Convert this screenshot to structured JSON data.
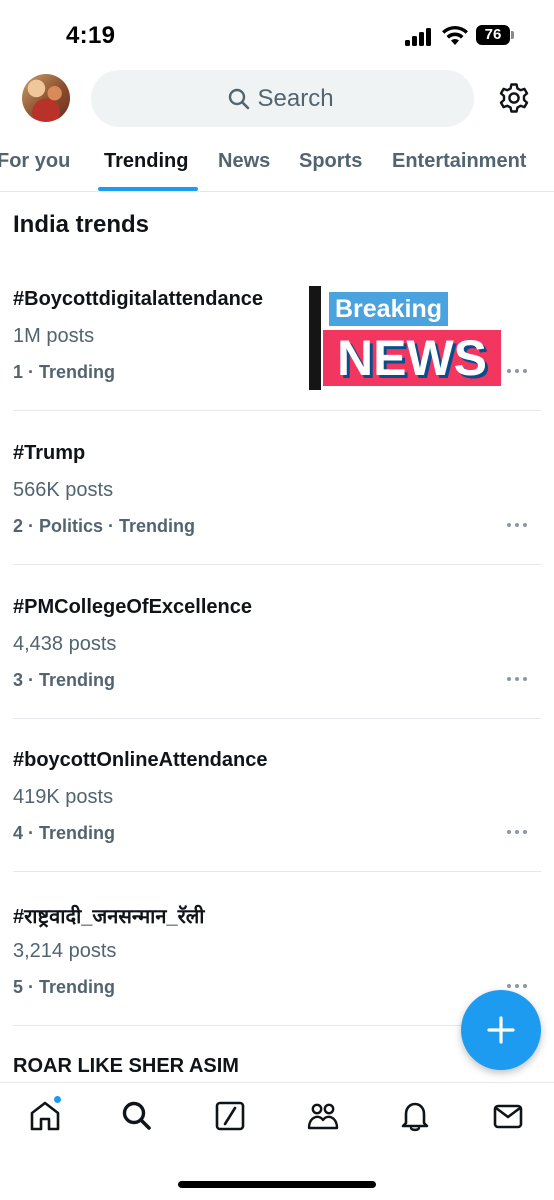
{
  "status_bar": {
    "time": "4:19",
    "battery": "76"
  },
  "header": {
    "search_placeholder": "Search"
  },
  "tabs": [
    {
      "label": "For you",
      "active": false
    },
    {
      "label": "Trending",
      "active": true
    },
    {
      "label": "News",
      "active": false
    },
    {
      "label": "Sports",
      "active": false
    },
    {
      "label": "Entertainment",
      "active": false
    }
  ],
  "section_title": "India trends",
  "trends": [
    {
      "name": "#Boycottdigitalattendance",
      "posts": "1M posts",
      "meta": "1 · Trending"
    },
    {
      "name": "#Trump",
      "posts": "566K posts",
      "meta": "2 · Politics · Trending"
    },
    {
      "name": "#PMCollegeOfExcellence",
      "posts": "4,438 posts",
      "meta": "3 · Trending"
    },
    {
      "name": "#boycottOnlineAttendance",
      "posts": "419K posts",
      "meta": "4 · Trending"
    },
    {
      "name": "#राष्ट्रवादी_जनसन्मान_रॅली",
      "posts": "3,214 posts",
      "meta": "5 · Trending"
    },
    {
      "name": "ROAR LIKE SHER ASIM"
    }
  ],
  "thumbnail": {
    "line1": "Breaking",
    "line2": "NEWS"
  },
  "colors": {
    "accent": "#1d9bf0",
    "text": "#0f1419",
    "secondary": "#536471",
    "breaking_blue": "#4aa3df",
    "news_red": "#f2365f"
  },
  "icons": {
    "search": "search-icon",
    "settings": "gear-icon",
    "compose": "plus-icon",
    "nav": [
      "home-icon",
      "search-icon",
      "grok-icon",
      "communities-icon",
      "notifications-icon",
      "messages-icon"
    ]
  }
}
